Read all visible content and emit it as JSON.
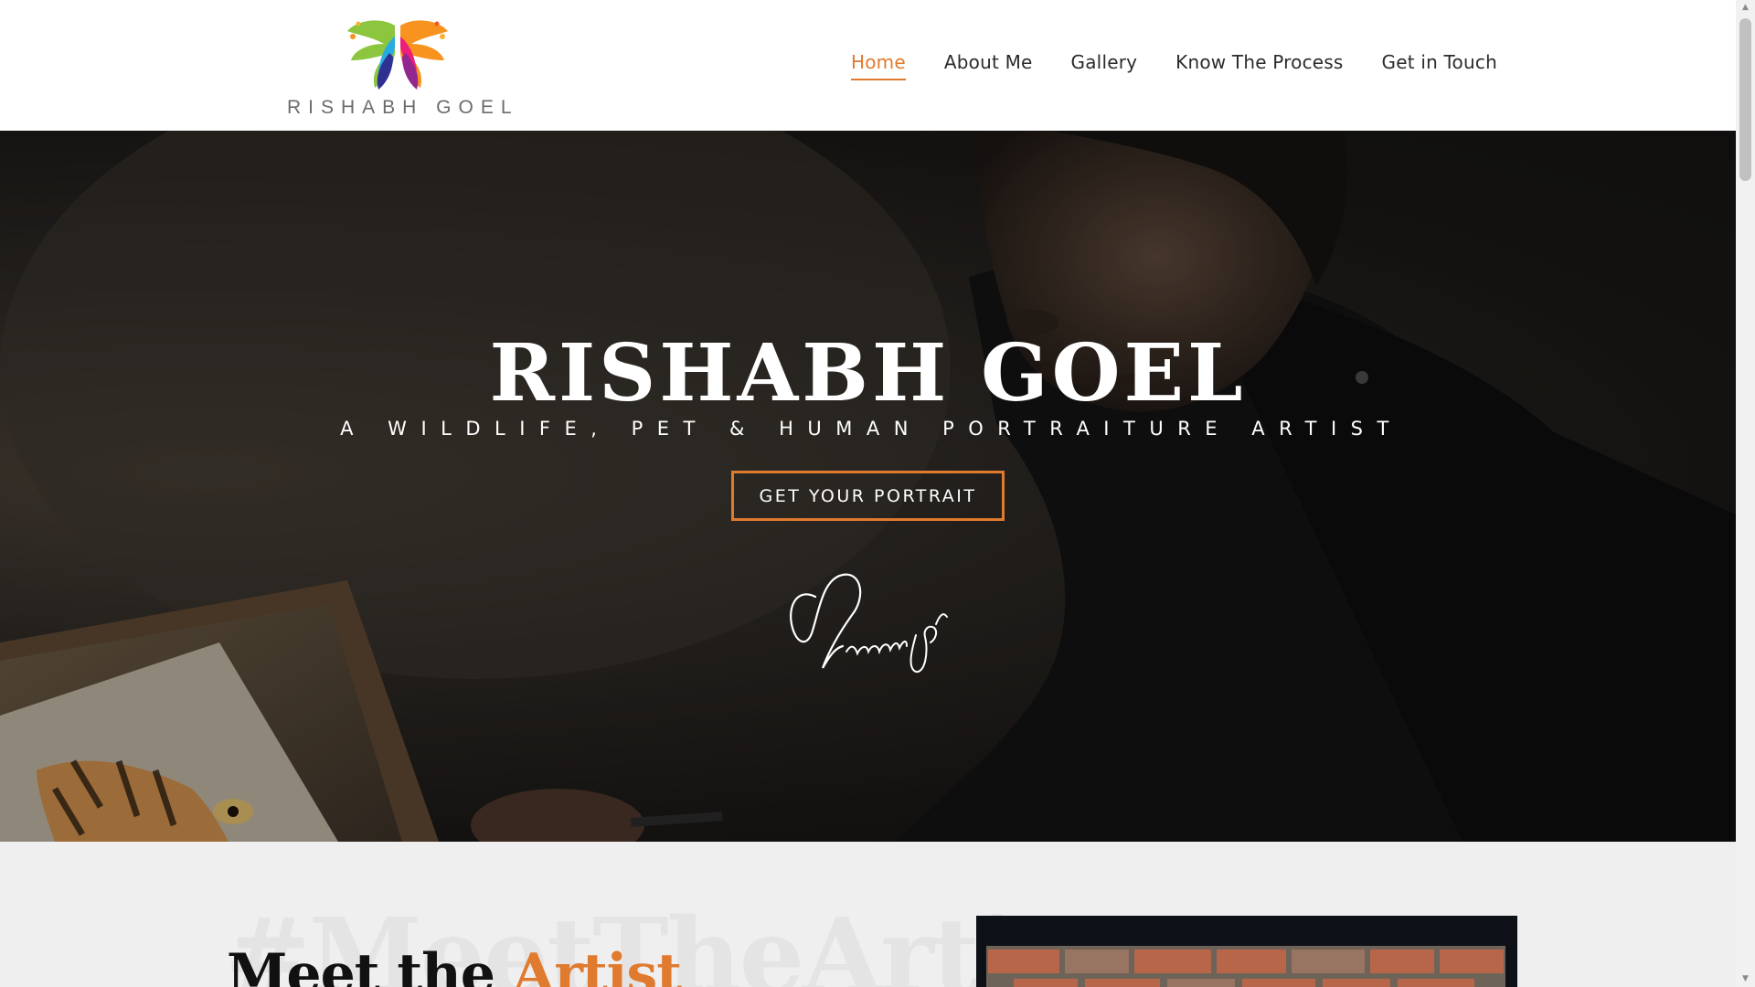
{
  "site": {
    "logo_text": "RISHABH GOEL",
    "accent_color": "#e07a2e"
  },
  "nav": {
    "items": [
      {
        "label": "Home",
        "active": true
      },
      {
        "label": "About Me",
        "active": false
      },
      {
        "label": "Gallery",
        "active": false
      },
      {
        "label": "Know The Process",
        "active": false
      },
      {
        "label": "Get in Touch",
        "active": false
      }
    ]
  },
  "hero": {
    "title": "RISHABH GOEL",
    "subtitle": "A WILDLIFE, PET & HUMAN PORTRAITURE ARTIST",
    "cta_label": "GET YOUR PORTRAIT",
    "signature_text": "Rishabh goel"
  },
  "about": {
    "watermark": "#MeetTheArtist",
    "heading_prefix": "Meet the",
    "heading_accent": "Artist"
  },
  "icons": {
    "logo": "butterfly-logo-icon",
    "scroll_up": "chevron-up-icon",
    "scroll_down": "chevron-down-icon"
  }
}
